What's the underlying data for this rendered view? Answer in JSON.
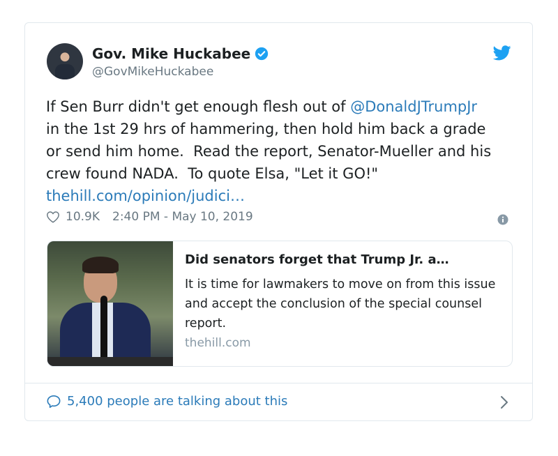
{
  "author": {
    "name": "Gov. Mike Huckabee",
    "handle": "@GovMikeHuckabee",
    "verified_icon": "verified-badge-icon"
  },
  "tweet": {
    "text_before": "If Sen Burr didn't get enough flesh out of ",
    "mention": "@DonaldJTrumpJr",
    "text_after": " in the 1st 29 hrs of hammering, then hold him back a grade or send him home.  Read the report, Senator-Mueller and his crew found NADA.  To quote Elsa, \"Let it GO!\"  ",
    "link": "thehill.com/opinion/judici…",
    "likes": "10.9K",
    "timestamp": "2:40 PM - May 10, 2019"
  },
  "link_card": {
    "title": "Did senators forget that Trump Jr. a…",
    "description": "It is time for lawmakers to move on from this issue and accept the conclusion of the special counsel report.",
    "domain": "thehill.com"
  },
  "footer": {
    "talking": "5,400 people are talking about this"
  },
  "colors": {
    "link": "#2b7bb9",
    "muted": "#697882",
    "border": "#e1e8ed",
    "twitter_blue": "#1da1f2"
  }
}
